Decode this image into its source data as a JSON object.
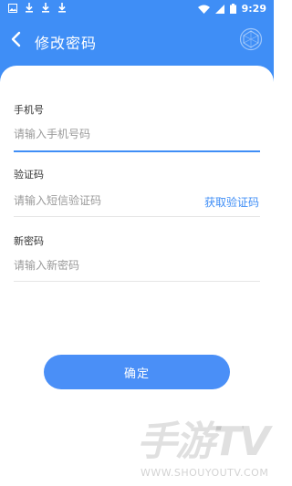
{
  "status_bar": {
    "time": "9:29",
    "left_icons": [
      "image-icon",
      "download-icon",
      "download-icon",
      "download-icon"
    ],
    "right_icons": [
      "wifi-icon",
      "signal-icon",
      "battery-icon"
    ]
  },
  "header": {
    "title": "修改密码",
    "back_icon": "chevron-left-icon",
    "right_icon": "logo-icon"
  },
  "form": {
    "phone": {
      "label": "手机号",
      "placeholder": "请输入手机号码",
      "value": ""
    },
    "code": {
      "label": "验证码",
      "placeholder": "请输入短信验证码",
      "value": "",
      "get_code_label": "获取验证码"
    },
    "new_password": {
      "label": "新密码",
      "placeholder": "请输入新密码",
      "value": ""
    }
  },
  "confirm_label": "确定",
  "watermark": {
    "text": "手游TV",
    "url_text": "WWW.SHOUYOUTV.COM"
  },
  "colors": {
    "accent": "#3f8ef6",
    "button": "#4a8ff7"
  }
}
